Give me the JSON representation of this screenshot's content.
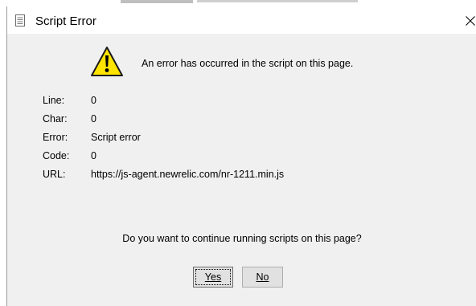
{
  "window": {
    "title": "Script Error",
    "close_icon": "close-icon"
  },
  "message": {
    "icon": "warning-icon",
    "text": "An error has occurred in the script on this page."
  },
  "details": [
    {
      "label": "Line:",
      "value": "0"
    },
    {
      "label": "Char:",
      "value": "0"
    },
    {
      "label": "Error:",
      "value": "Script error"
    },
    {
      "label": "Code:",
      "value": "0"
    },
    {
      "label": "URL:",
      "value": "https://js-agent.newrelic.com/nr-1211.min.js"
    }
  ],
  "question": "Do you want to continue running scripts on this page?",
  "buttons": {
    "yes_label": "Yes",
    "no_label": "No"
  },
  "colors": {
    "dialog_bg": "#f0f0f0",
    "titlebar_bg": "#ffffff",
    "warning_yellow": "#ffe400"
  }
}
